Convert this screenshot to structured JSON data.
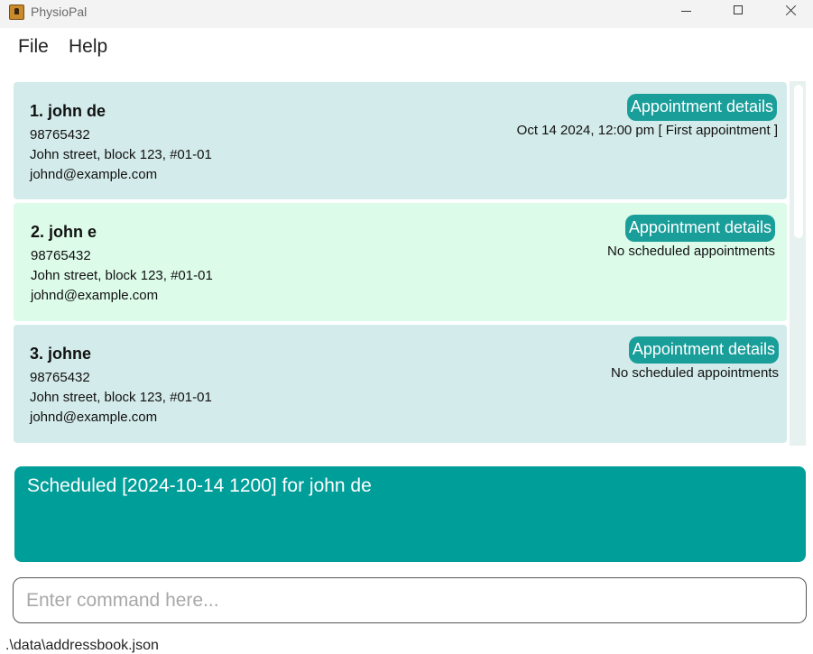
{
  "window": {
    "title": "PhysioPal"
  },
  "menu": {
    "file": "File",
    "help": "Help"
  },
  "persons": [
    {
      "name": "1. john de",
      "phone": "98765432",
      "address": "John street, block 123, #01-01",
      "email": "johnd@example.com",
      "button": "Appointment details",
      "appointment": "Oct 14 2024, 12:00 pm [ First appointment ]"
    },
    {
      "name": "2. john e",
      "phone": "98765432",
      "address": "John street, block 123, #01-01",
      "email": "johnd@example.com",
      "button": "Appointment details",
      "appointment": "No scheduled appointments"
    },
    {
      "name": "3. johne",
      "phone": "98765432",
      "address": "John street, block 123, #01-01",
      "email": "johnd@example.com",
      "button": "Appointment details",
      "appointment": "No scheduled appointments"
    }
  ],
  "result": {
    "message": "Scheduled [2024-10-14 1200] for john de"
  },
  "command": {
    "placeholder": "Enter command here...",
    "value": ""
  },
  "status": {
    "path": ".\\data\\addressbook.json"
  },
  "colors": {
    "accent": "#009e99",
    "card_blue": "#d3ebea",
    "card_green": "#dcfbe9",
    "button": "#1a9e9a"
  },
  "icons": {
    "app": "app-icon",
    "minimize": "minimize-icon",
    "maximize": "maximize-icon",
    "close": "close-icon"
  }
}
